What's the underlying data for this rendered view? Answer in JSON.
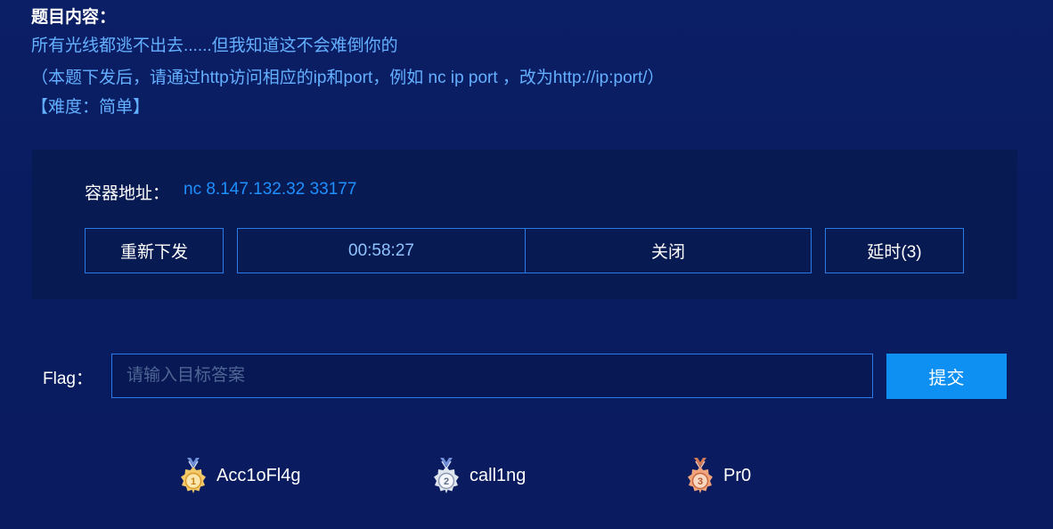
{
  "problem": {
    "title": "题目内容：",
    "description": "所有光线都逃不出去......但我知道这不会难倒你的",
    "note": "（本题下发后，请通过http访问相应的ip和port，例如 nc ip port ，改为http://ip:port/）",
    "difficulty": "【难度：简单】"
  },
  "container": {
    "address_label": "容器地址：",
    "address_value": "nc 8.147.132.32 33177",
    "reissue_label": "重新下发",
    "timer": "00:58:27",
    "close_label": "关闭",
    "extend_label": "延时(3)"
  },
  "flag": {
    "label": "Flag：",
    "placeholder": "请输入目标答案",
    "value": "",
    "submit_label": "提交"
  },
  "solvers": [
    {
      "rank": "1",
      "name": "Acc1oFl4g",
      "medal": "gold-medal-icon",
      "color": "#e8b64a"
    },
    {
      "rank": "2",
      "name": "call1ng",
      "medal": "silver-medal-icon",
      "color": "#c9d2e2"
    },
    {
      "rank": "3",
      "name": "Pr0",
      "medal": "bronze-medal-icon",
      "color": "#e08a5e"
    }
  ]
}
